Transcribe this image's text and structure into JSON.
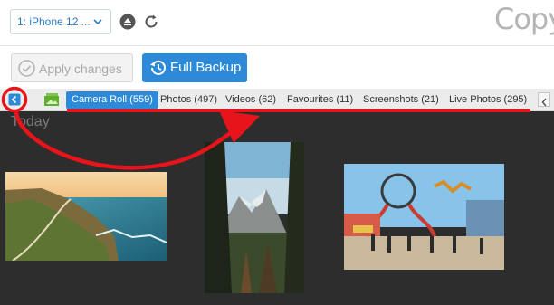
{
  "device": {
    "selected": "1: iPhone 12 ...",
    "chevron": "⌄"
  },
  "brand": {
    "logo_text": "CopyT"
  },
  "toolbar": {
    "apply_label": "Apply changes",
    "backup_label": "Full Backup"
  },
  "tabs": [
    {
      "label": "Camera Roll (559)"
    },
    {
      "label": "Photos (497)"
    },
    {
      "label": "Videos (62)"
    },
    {
      "label": "Favourites (11)"
    },
    {
      "label": "Screenshots (21)"
    },
    {
      "label": "Live Photos (295)"
    }
  ],
  "gallery": {
    "section_label": "Today"
  },
  "icons": {
    "eject": "eject-icon",
    "refresh": "refresh-icon",
    "check": "check-circle-icon",
    "backup": "history-icon",
    "collapse": "sidebar-collapse-icon",
    "photos_app": "photos-app-icon",
    "scroll_left": "chevron-left-icon"
  },
  "colors": {
    "accent": "#2c8ad8",
    "annotation": "#e8141b",
    "content_bg": "#2d2d2d"
  }
}
